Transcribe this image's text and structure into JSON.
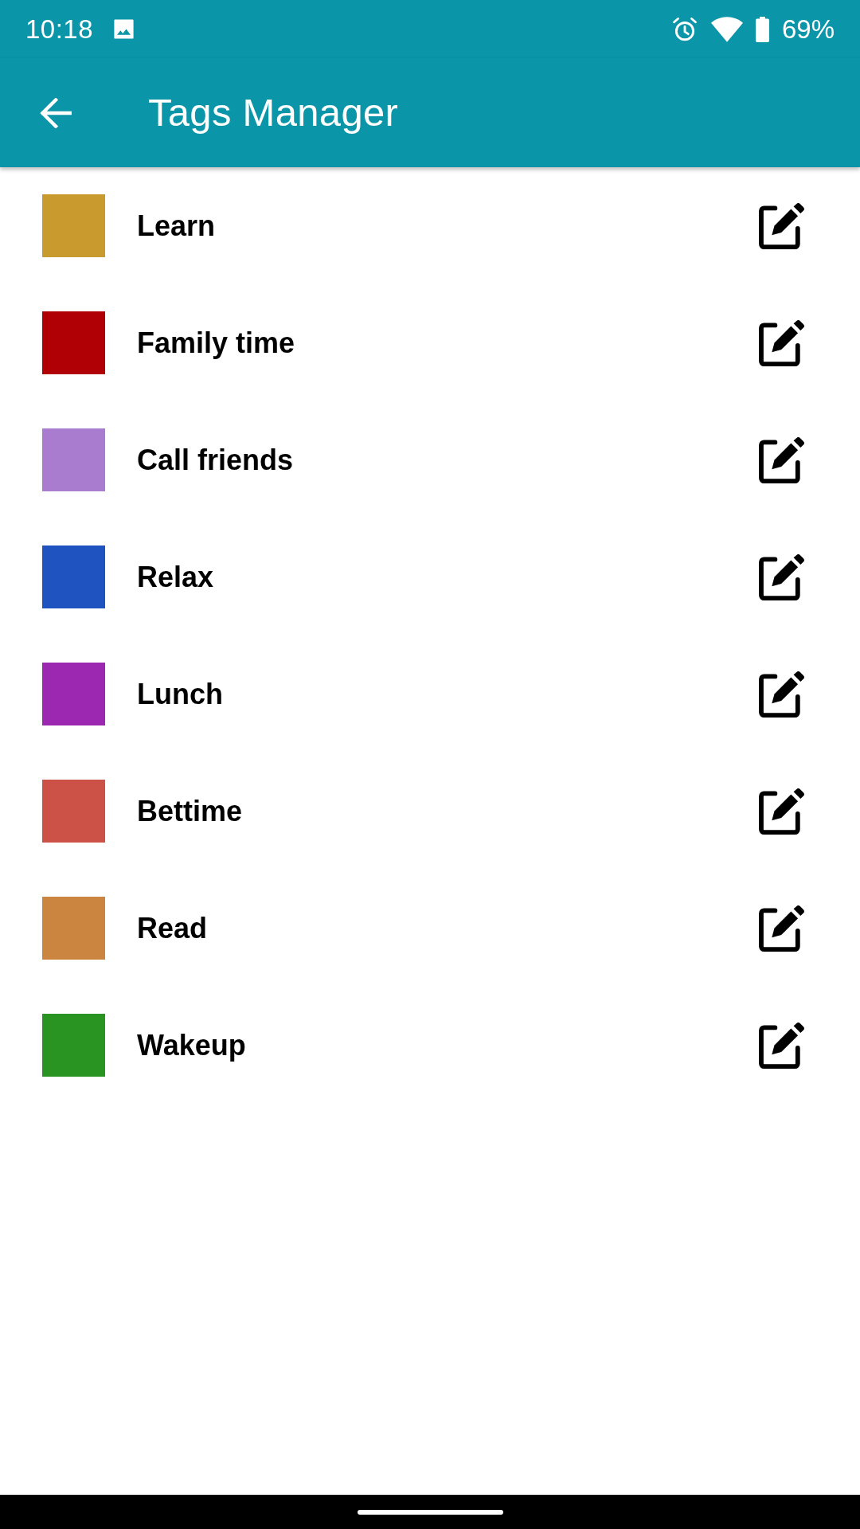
{
  "status_bar": {
    "time": "10:18",
    "battery": "69%"
  },
  "app_bar": {
    "title": "Tags Manager"
  },
  "tags": [
    {
      "name": "Learn",
      "color": "#c99a2e"
    },
    {
      "name": "Family time",
      "color": "#b00006"
    },
    {
      "name": "Call friends",
      "color": "#a97ccf"
    },
    {
      "name": "Relax",
      "color": "#1f54c0"
    },
    {
      "name": "Lunch",
      "color": "#9c27b0"
    },
    {
      "name": "Bettime",
      "color": "#cc5147"
    },
    {
      "name": "Read",
      "color": "#cc8540"
    },
    {
      "name": "Wakeup",
      "color": "#2a9423"
    }
  ]
}
